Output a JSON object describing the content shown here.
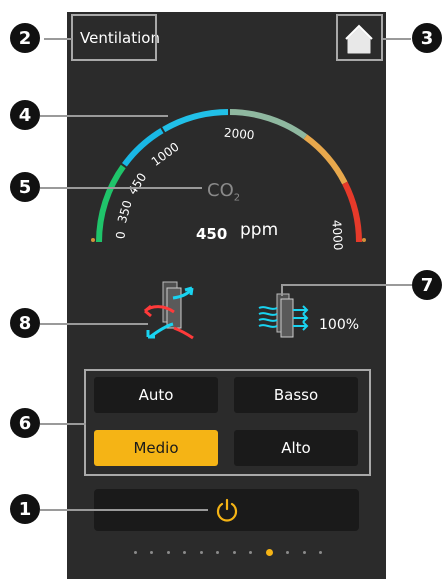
{
  "header": {
    "title": "Ventilation",
    "home_icon": "home-icon"
  },
  "gauge": {
    "value_label": "450",
    "unit": "ppm",
    "sensor_label": "CO",
    "sensor_subscript": "2",
    "ticks": [
      "0",
      "350",
      "450",
      "1000",
      "2000",
      "4000"
    ],
    "value": 450,
    "min": 0,
    "max": 4000
  },
  "airflow": {
    "recovery_icon": "heat-recovery-icon",
    "extract_icon": "extract-airflow-icon",
    "extract_percent": "100%"
  },
  "modes": {
    "auto": "Auto",
    "low": "Basso",
    "medium": "Medio",
    "high": "Alto",
    "selected": "Medio"
  },
  "power": {
    "icon": "power-icon"
  },
  "pager": {
    "count": 12,
    "active_index": 8
  },
  "callouts": [
    "1",
    "2",
    "3",
    "4",
    "5",
    "6",
    "7",
    "8"
  ],
  "colors": {
    "background": "#2b2b2b",
    "accent": "#f5b415",
    "gauge_green": "#1fc46a",
    "gauge_cyan": "#19b8e6",
    "gauge_orange": "#f0913d",
    "gauge_red": "#e63a2a"
  }
}
